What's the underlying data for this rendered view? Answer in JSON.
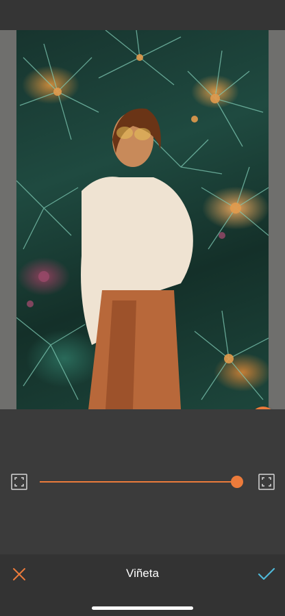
{
  "colors": {
    "accent": "#ec7b3b",
    "confirm": "#4fb8d8",
    "background": "#3b3b3b",
    "bottom_bar": "#333333"
  },
  "icons": {
    "split_view": "split-compare-icon",
    "frame_min": "frame-corners-icon",
    "frame_max": "frame-corners-icon",
    "cancel": "close-icon",
    "confirm": "checkmark-icon"
  },
  "tool": {
    "title": "Viñeta"
  },
  "slider": {
    "value_fraction": 0.96
  }
}
